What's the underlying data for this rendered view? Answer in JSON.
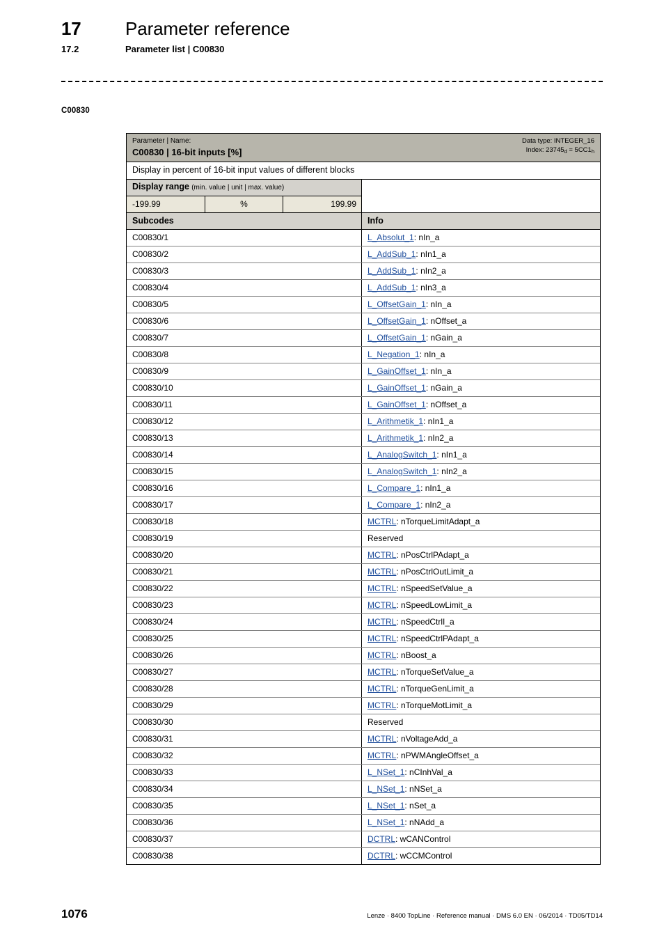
{
  "header": {
    "chapter_number": "17",
    "chapter_title": "Parameter reference",
    "section_number": "17.2",
    "section_title": "Parameter list | C00830"
  },
  "margin_tag": "C00830",
  "parameter": {
    "head_caption": "Parameter | Name:",
    "head_name": "C00830 | 16-bit inputs [%]",
    "data_type_label": "Data type: INTEGER_16",
    "index_prefix": "Index: 23745",
    "index_sub_dec": "d",
    "index_middle": " = 5CC1",
    "index_sub_hex": "h",
    "description": "Display in percent of 16-bit input values of different blocks",
    "range_title_bold": "Display range",
    "range_title_small": "(min. value | unit | max. value)",
    "range_min": "-199.99",
    "range_unit": "%",
    "range_max": "199.99"
  },
  "table": {
    "col_subcodes": "Subcodes",
    "col_info": "Info",
    "rows": [
      {
        "subcode": "C00830/1",
        "link": "L_Absolut_1",
        "value": ": nIn_a"
      },
      {
        "subcode": "C00830/2",
        "link": "L_AddSub_1",
        "value": ": nIn1_a"
      },
      {
        "subcode": "C00830/3",
        "link": "L_AddSub_1",
        "value": ": nIn2_a"
      },
      {
        "subcode": "C00830/4",
        "link": "L_AddSub_1",
        "value": ": nIn3_a"
      },
      {
        "subcode": "C00830/5",
        "link": "L_OffsetGain_1",
        "value": ": nIn_a"
      },
      {
        "subcode": "C00830/6",
        "link": "L_OffsetGain_1",
        "value": ": nOffset_a"
      },
      {
        "subcode": "C00830/7",
        "link": "L_OffsetGain_1",
        "value": ": nGain_a"
      },
      {
        "subcode": "C00830/8",
        "link": "L_Negation_1",
        "value": ": nIn_a"
      },
      {
        "subcode": "C00830/9",
        "link": "L_GainOffset_1",
        "value": ": nIn_a"
      },
      {
        "subcode": "C00830/10",
        "link": "L_GainOffset_1",
        "value": ": nGain_a"
      },
      {
        "subcode": "C00830/11",
        "link": "L_GainOffset_1",
        "value": ": nOffset_a"
      },
      {
        "subcode": "C00830/12",
        "link": "L_Arithmetik_1",
        "value": ": nIn1_a"
      },
      {
        "subcode": "C00830/13",
        "link": "L_Arithmetik_1",
        "value": ": nIn2_a"
      },
      {
        "subcode": "C00830/14",
        "link": "L_AnalogSwitch_1",
        "value": ": nIn1_a"
      },
      {
        "subcode": "C00830/15",
        "link": "L_AnalogSwitch_1",
        "value": ": nIn2_a"
      },
      {
        "subcode": "C00830/16",
        "link": "L_Compare_1",
        "value": ": nIn1_a"
      },
      {
        "subcode": "C00830/17",
        "link": "L_Compare_1",
        "value": ": nIn2_a"
      },
      {
        "subcode": "C00830/18",
        "link": "MCTRL",
        "value": ": nTorqueLimitAdapt_a"
      },
      {
        "subcode": "C00830/19",
        "link": "",
        "value": "Reserved"
      },
      {
        "subcode": "C00830/20",
        "link": "MCTRL",
        "value": ": nPosCtrlPAdapt_a"
      },
      {
        "subcode": "C00830/21",
        "link": "MCTRL",
        "value": ": nPosCtrlOutLimit_a"
      },
      {
        "subcode": "C00830/22",
        "link": "MCTRL",
        "value": ": nSpeedSetValue_a"
      },
      {
        "subcode": "C00830/23",
        "link": "MCTRL",
        "value": ": nSpeedLowLimit_a"
      },
      {
        "subcode": "C00830/24",
        "link": "MCTRL",
        "value": ": nSpeedCtrlI_a"
      },
      {
        "subcode": "C00830/25",
        "link": "MCTRL",
        "value": ": nSpeedCtrlPAdapt_a"
      },
      {
        "subcode": "C00830/26",
        "link": "MCTRL",
        "value": ": nBoost_a"
      },
      {
        "subcode": "C00830/27",
        "link": "MCTRL",
        "value": ": nTorqueSetValue_a"
      },
      {
        "subcode": "C00830/28",
        "link": "MCTRL",
        "value": ": nTorqueGenLimit_a"
      },
      {
        "subcode": "C00830/29",
        "link": "MCTRL",
        "value": ": nTorqueMotLimit_a"
      },
      {
        "subcode": "C00830/30",
        "link": "",
        "value": "Reserved"
      },
      {
        "subcode": "C00830/31",
        "link": "MCTRL",
        "value": ": nVoltageAdd_a"
      },
      {
        "subcode": "C00830/32",
        "link": "MCTRL",
        "value": ": nPWMAngleOffset_a"
      },
      {
        "subcode": "C00830/33",
        "link": "L_NSet_1",
        "value": ": nCInhVal_a"
      },
      {
        "subcode": "C00830/34",
        "link": "L_NSet_1",
        "value": ": nNSet_a"
      },
      {
        "subcode": "C00830/35",
        "link": "L_NSet_1",
        "value": ": nSet_a"
      },
      {
        "subcode": "C00830/36",
        "link": "L_NSet_1",
        "value": ": nNAdd_a"
      },
      {
        "subcode": "C00830/37",
        "link": "DCTRL",
        "value": ": wCANControl"
      },
      {
        "subcode": "C00830/38",
        "link": "DCTRL",
        "value": ": wCCMControl"
      }
    ]
  },
  "footer": {
    "page_number": "1076",
    "text": "Lenze · 8400 TopLine · Reference manual · DMS 6.0 EN · 06/2014 · TD05/TD14"
  },
  "colors": {
    "head_band": "#b7b5ab",
    "subhead_band": "#d4d2cc",
    "range_value_band": "#eae7da",
    "link": "#1f4e9c"
  }
}
